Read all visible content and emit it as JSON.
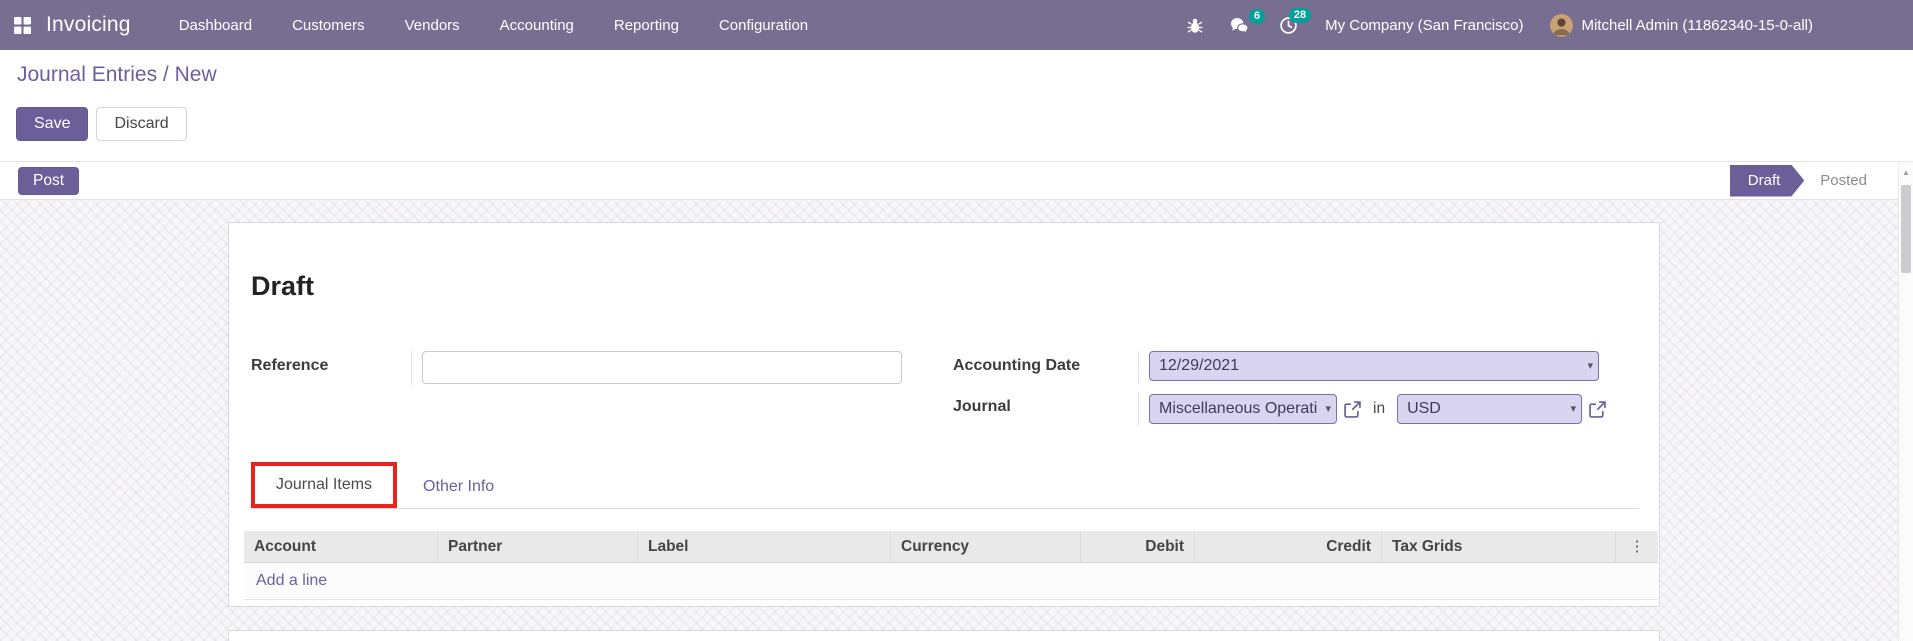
{
  "navbar": {
    "brand": "Invoicing",
    "menus": [
      "Dashboard",
      "Customers",
      "Vendors",
      "Accounting",
      "Reporting",
      "Configuration"
    ],
    "messages_badge": "6",
    "activities_badge": "28",
    "company": "My Company (San Francisco)",
    "user": "Mitchell Admin (11862340-15-0-all)"
  },
  "breadcrumb": {
    "parent": "Journal Entries",
    "separator": " / ",
    "current": "New"
  },
  "actions": {
    "save": "Save",
    "discard": "Discard",
    "post": "Post"
  },
  "statusbar": {
    "current": "Draft",
    "next": "Posted"
  },
  "form": {
    "title": "Draft",
    "reference": {
      "label": "Reference",
      "value": ""
    },
    "accounting_date": {
      "label": "Accounting Date",
      "value": "12/29/2021"
    },
    "journal": {
      "label": "Journal",
      "value": "Miscellaneous Operati",
      "in_word": "in",
      "currency": "USD"
    }
  },
  "tabs": {
    "journal_items": "Journal Items",
    "other_info": "Other Info"
  },
  "journal_items_table": {
    "columns": [
      "Account",
      "Partner",
      "Label",
      "Currency",
      "Debit",
      "Credit",
      "Tax Grids"
    ],
    "add_line": "Add a line",
    "rows": []
  },
  "icons": {
    "caret_down": "▾",
    "kebab": "⋮",
    "scroll_up": "▲"
  },
  "colors": {
    "navbar_bg": "#786e92",
    "accent": "#6c5f99",
    "link": "#6d5f9e",
    "badge": "#00a09d",
    "field_bg": "#d9d5f0",
    "field_border": "#7b6fae",
    "annotation": "#e8231d",
    "table_header_bg": "#e9e9e9"
  }
}
